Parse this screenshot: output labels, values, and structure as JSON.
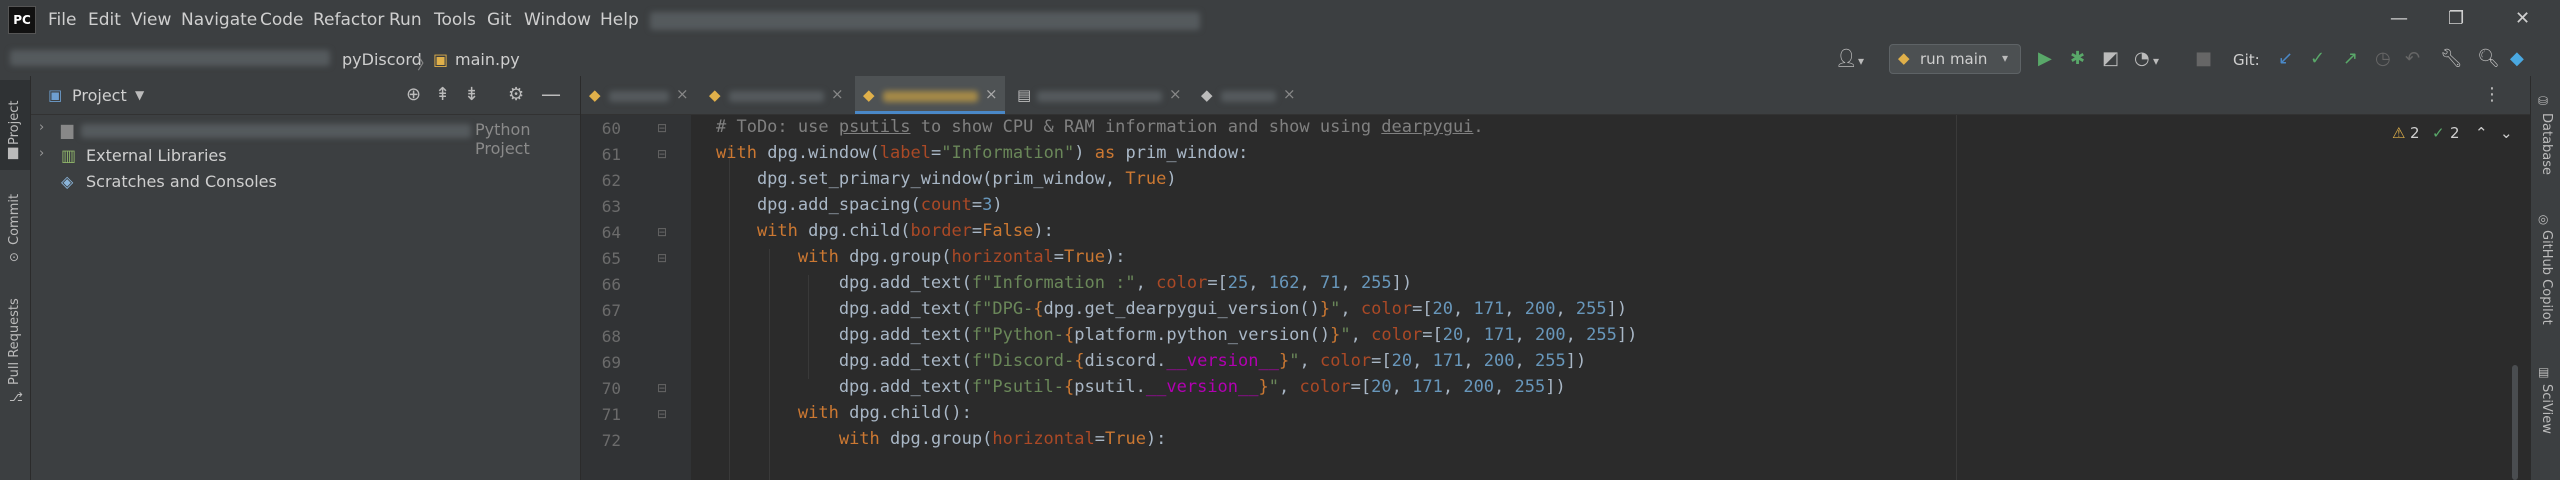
{
  "menu": {
    "app_logo": "PC",
    "items": [
      {
        "label": "File"
      },
      {
        "label": "Edit"
      },
      {
        "label": "View"
      },
      {
        "label": "Navigate"
      },
      {
        "label": "Code"
      },
      {
        "label": "Refactor"
      },
      {
        "label": "Run"
      },
      {
        "label": "Tools"
      },
      {
        "label": "Git"
      },
      {
        "label": "Window"
      },
      {
        "label": "Help"
      }
    ]
  },
  "breadcrumb": {
    "project": "pyDiscord",
    "file": "main.py"
  },
  "toolbar": {
    "run_config": "run main",
    "git_label": "Git:"
  },
  "left_stripe": {
    "project": "Project",
    "commit": "Commit",
    "pull_requests": "Pull Requests"
  },
  "right_stripe": {
    "database": "Database",
    "copilot": "GitHub Copilot",
    "sciview": "SciView"
  },
  "project_panel": {
    "title": "Project",
    "tree": [
      {
        "label": "",
        "suffix": "Python Project"
      },
      {
        "label": "External Libraries"
      },
      {
        "label": "Scratches and Consoles"
      }
    ]
  },
  "inspections": {
    "warnings": "2",
    "ok": "2"
  },
  "editor": {
    "line_numbers": [
      "60",
      "61",
      "62",
      "63",
      "64",
      "65",
      "66",
      "67",
      "68",
      "69",
      "70",
      "71",
      "72"
    ]
  },
  "colors": {
    "keyword": "#cc7832",
    "number": "#6897bb",
    "string": "#6a8759",
    "param": "#aa4926",
    "comment": "#808080"
  }
}
